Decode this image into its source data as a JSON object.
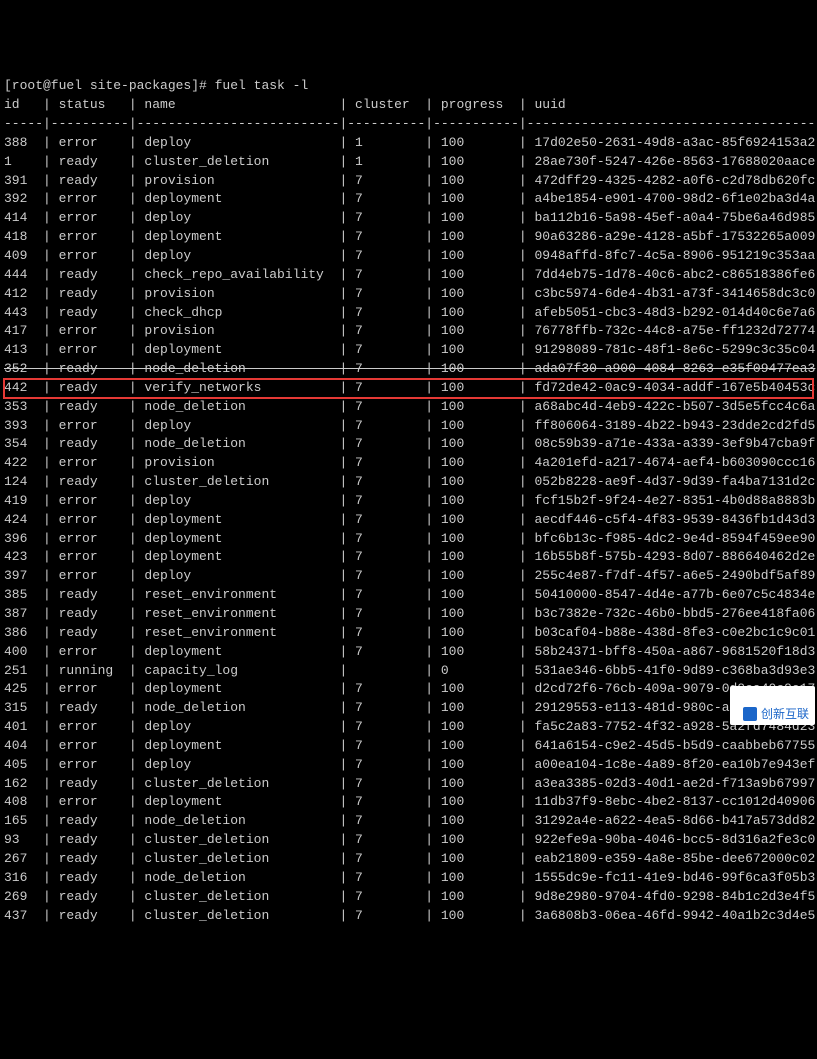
{
  "prompt": "[root@fuel site-packages]# fuel task -l",
  "columns": [
    "id",
    "status",
    "name",
    "cluster",
    "progress",
    "uuid"
  ],
  "highlight_id": "442",
  "strike_before_highlight_id": "352",
  "rows": [
    {
      "id": "388",
      "status": "error",
      "name": "deploy",
      "cluster": "1",
      "progress": "100",
      "uuid": "17d02e50-2631-49d8-a3ac-85f6924153a2"
    },
    {
      "id": "1",
      "status": "ready",
      "name": "cluster_deletion",
      "cluster": "1",
      "progress": "100",
      "uuid": "28ae730f-5247-426e-8563-17688020aace"
    },
    {
      "id": "391",
      "status": "ready",
      "name": "provision",
      "cluster": "7",
      "progress": "100",
      "uuid": "472dff29-4325-4282-a0f6-c2d78db620fc"
    },
    {
      "id": "392",
      "status": "error",
      "name": "deployment",
      "cluster": "7",
      "progress": "100",
      "uuid": "a4be1854-e901-4700-98d2-6f1e02ba3d4a"
    },
    {
      "id": "414",
      "status": "error",
      "name": "deploy",
      "cluster": "7",
      "progress": "100",
      "uuid": "ba112b16-5a98-45ef-a0a4-75be6a46d985"
    },
    {
      "id": "418",
      "status": "error",
      "name": "deployment",
      "cluster": "7",
      "progress": "100",
      "uuid": "90a63286-a29e-4128-a5bf-17532265a009"
    },
    {
      "id": "409",
      "status": "error",
      "name": "deploy",
      "cluster": "7",
      "progress": "100",
      "uuid": "0948affd-8fc7-4c5a-8906-951219c353aa"
    },
    {
      "id": "444",
      "status": "ready",
      "name": "check_repo_availability",
      "cluster": "7",
      "progress": "100",
      "uuid": "7dd4eb75-1d78-40c6-abc2-c86518386fe6"
    },
    {
      "id": "412",
      "status": "ready",
      "name": "provision",
      "cluster": "7",
      "progress": "100",
      "uuid": "c3bc5974-6de4-4b31-a73f-3414658dc3c0"
    },
    {
      "id": "443",
      "status": "ready",
      "name": "check_dhcp",
      "cluster": "7",
      "progress": "100",
      "uuid": "afeb5051-cbc3-48d3-b292-014d40c6e7a6"
    },
    {
      "id": "417",
      "status": "error",
      "name": "provision",
      "cluster": "7",
      "progress": "100",
      "uuid": "76778ffb-732c-44c8-a75e-ff1232d72774"
    },
    {
      "id": "413",
      "status": "error",
      "name": "deployment",
      "cluster": "7",
      "progress": "100",
      "uuid": "91298089-781c-48f1-8e6c-5299c3c35c04"
    },
    {
      "id": "352",
      "status": "ready",
      "name": "node_deletion",
      "cluster": "7",
      "progress": "100",
      "uuid": "ada07f30-a900-4084-8263-e35f09477ea3"
    },
    {
      "id": "442",
      "status": "ready",
      "name": "verify_networks",
      "cluster": "7",
      "progress": "100",
      "uuid": "fd72de42-0ac9-4034-addf-167e5b40453c"
    },
    {
      "id": "353",
      "status": "ready",
      "name": "node_deletion",
      "cluster": "7",
      "progress": "100",
      "uuid": "a68abc4d-4eb9-422c-b507-3d5e5fcc4c6a"
    },
    {
      "id": "393",
      "status": "error",
      "name": "deploy",
      "cluster": "7",
      "progress": "100",
      "uuid": "ff806064-3189-4b22-b943-23dde2cd2fd5"
    },
    {
      "id": "354",
      "status": "ready",
      "name": "node_deletion",
      "cluster": "7",
      "progress": "100",
      "uuid": "08c59b39-a71e-433a-a339-3ef9b47cba9f"
    },
    {
      "id": "422",
      "status": "error",
      "name": "provision",
      "cluster": "7",
      "progress": "100",
      "uuid": "4a201efd-a217-4674-aef4-b603090ccc16"
    },
    {
      "id": "124",
      "status": "ready",
      "name": "cluster_deletion",
      "cluster": "7",
      "progress": "100",
      "uuid": "052b8228-ae9f-4d37-9d39-fa4ba7131d2c"
    },
    {
      "id": "419",
      "status": "error",
      "name": "deploy",
      "cluster": "7",
      "progress": "100",
      "uuid": "fcf15b2f-9f24-4e27-8351-4b0d88a8883b"
    },
    {
      "id": "424",
      "status": "error",
      "name": "deployment",
      "cluster": "7",
      "progress": "100",
      "uuid": "aecdf446-c5f4-4f83-9539-8436fb1d43d3"
    },
    {
      "id": "396",
      "status": "error",
      "name": "deployment",
      "cluster": "7",
      "progress": "100",
      "uuid": "bfc6b13c-f985-4dc2-9e4d-8594f459ee90"
    },
    {
      "id": "423",
      "status": "error",
      "name": "deployment",
      "cluster": "7",
      "progress": "100",
      "uuid": "16b55b8f-575b-4293-8d07-886640462d2e"
    },
    {
      "id": "397",
      "status": "error",
      "name": "deploy",
      "cluster": "7",
      "progress": "100",
      "uuid": "255c4e87-f7df-4f57-a6e5-2490bdf5af89"
    },
    {
      "id": "385",
      "status": "ready",
      "name": "reset_environment",
      "cluster": "7",
      "progress": "100",
      "uuid": "50410000-8547-4d4e-a77b-6e07c5c4834e"
    },
    {
      "id": "387",
      "status": "ready",
      "name": "reset_environment",
      "cluster": "7",
      "progress": "100",
      "uuid": "b3c7382e-732c-46b0-bbd5-276ee418fa06"
    },
    {
      "id": "386",
      "status": "ready",
      "name": "reset_environment",
      "cluster": "7",
      "progress": "100",
      "uuid": "b03caf04-b88e-438d-8fe3-c0e2bc1c9c01"
    },
    {
      "id": "400",
      "status": "error",
      "name": "deployment",
      "cluster": "7",
      "progress": "100",
      "uuid": "58b24371-bff8-450a-a867-9681520f18d3"
    },
    {
      "id": "251",
      "status": "running",
      "name": "capacity_log",
      "cluster": "",
      "progress": "0",
      "uuid": "531ae346-6bb5-41f0-9d89-c368ba3d93e3"
    },
    {
      "id": "425",
      "status": "error",
      "name": "deployment",
      "cluster": "7",
      "progress": "100",
      "uuid": "d2cd72f6-76cb-409a-9079-0d9ca40c9e17"
    },
    {
      "id": "315",
      "status": "ready",
      "name": "node_deletion",
      "cluster": "7",
      "progress": "100",
      "uuid": "29129553-e113-481d-980c-acf8afc1782d"
    },
    {
      "id": "401",
      "status": "error",
      "name": "deploy",
      "cluster": "7",
      "progress": "100",
      "uuid": "fa5c2a83-7752-4f32-a928-5a2fd7484d23"
    },
    {
      "id": "404",
      "status": "error",
      "name": "deployment",
      "cluster": "7",
      "progress": "100",
      "uuid": "641a6154-c9e2-45d5-b5d9-caabbeb67755"
    },
    {
      "id": "405",
      "status": "error",
      "name": "deploy",
      "cluster": "7",
      "progress": "100",
      "uuid": "a00ea104-1c8e-4a89-8f20-ea10b7e943ef"
    },
    {
      "id": "162",
      "status": "ready",
      "name": "cluster_deletion",
      "cluster": "7",
      "progress": "100",
      "uuid": "a3ea3385-02d3-40d1-ae2d-f713a9b67997"
    },
    {
      "id": "408",
      "status": "error",
      "name": "deployment",
      "cluster": "7",
      "progress": "100",
      "uuid": "11db37f9-8ebc-4be2-8137-cc1012d40906"
    },
    {
      "id": "165",
      "status": "ready",
      "name": "node_deletion",
      "cluster": "7",
      "progress": "100",
      "uuid": "31292a4e-a622-4ea5-8d66-b417a573dd82"
    },
    {
      "id": "93",
      "status": "ready",
      "name": "cluster_deletion",
      "cluster": "7",
      "progress": "100",
      "uuid": "922efe9a-90ba-4046-bcc5-8d316a2fe3c0"
    },
    {
      "id": "267",
      "status": "ready",
      "name": "cluster_deletion",
      "cluster": "7",
      "progress": "100",
      "uuid": "eab21809-e359-4a8e-85be-dee672000c02"
    },
    {
      "id": "316",
      "status": "ready",
      "name": "node_deletion",
      "cluster": "7",
      "progress": "100",
      "uuid": "1555dc9e-fc11-41e9-bd46-99f6ca3f05b3"
    },
    {
      "id": "269",
      "status": "ready",
      "name": "cluster_deletion",
      "cluster": "7",
      "progress": "100",
      "uuid": "9d8e2980-9704-4fd0-9298-84b1c2d3e4f5"
    },
    {
      "id": "437",
      "status": "ready",
      "name": "cluster_deletion",
      "cluster": "7",
      "progress": "100",
      "uuid": "3a6808b3-06ea-46fd-9942-40a1b2c3d4e5"
    }
  ],
  "watermark": "创新互联"
}
